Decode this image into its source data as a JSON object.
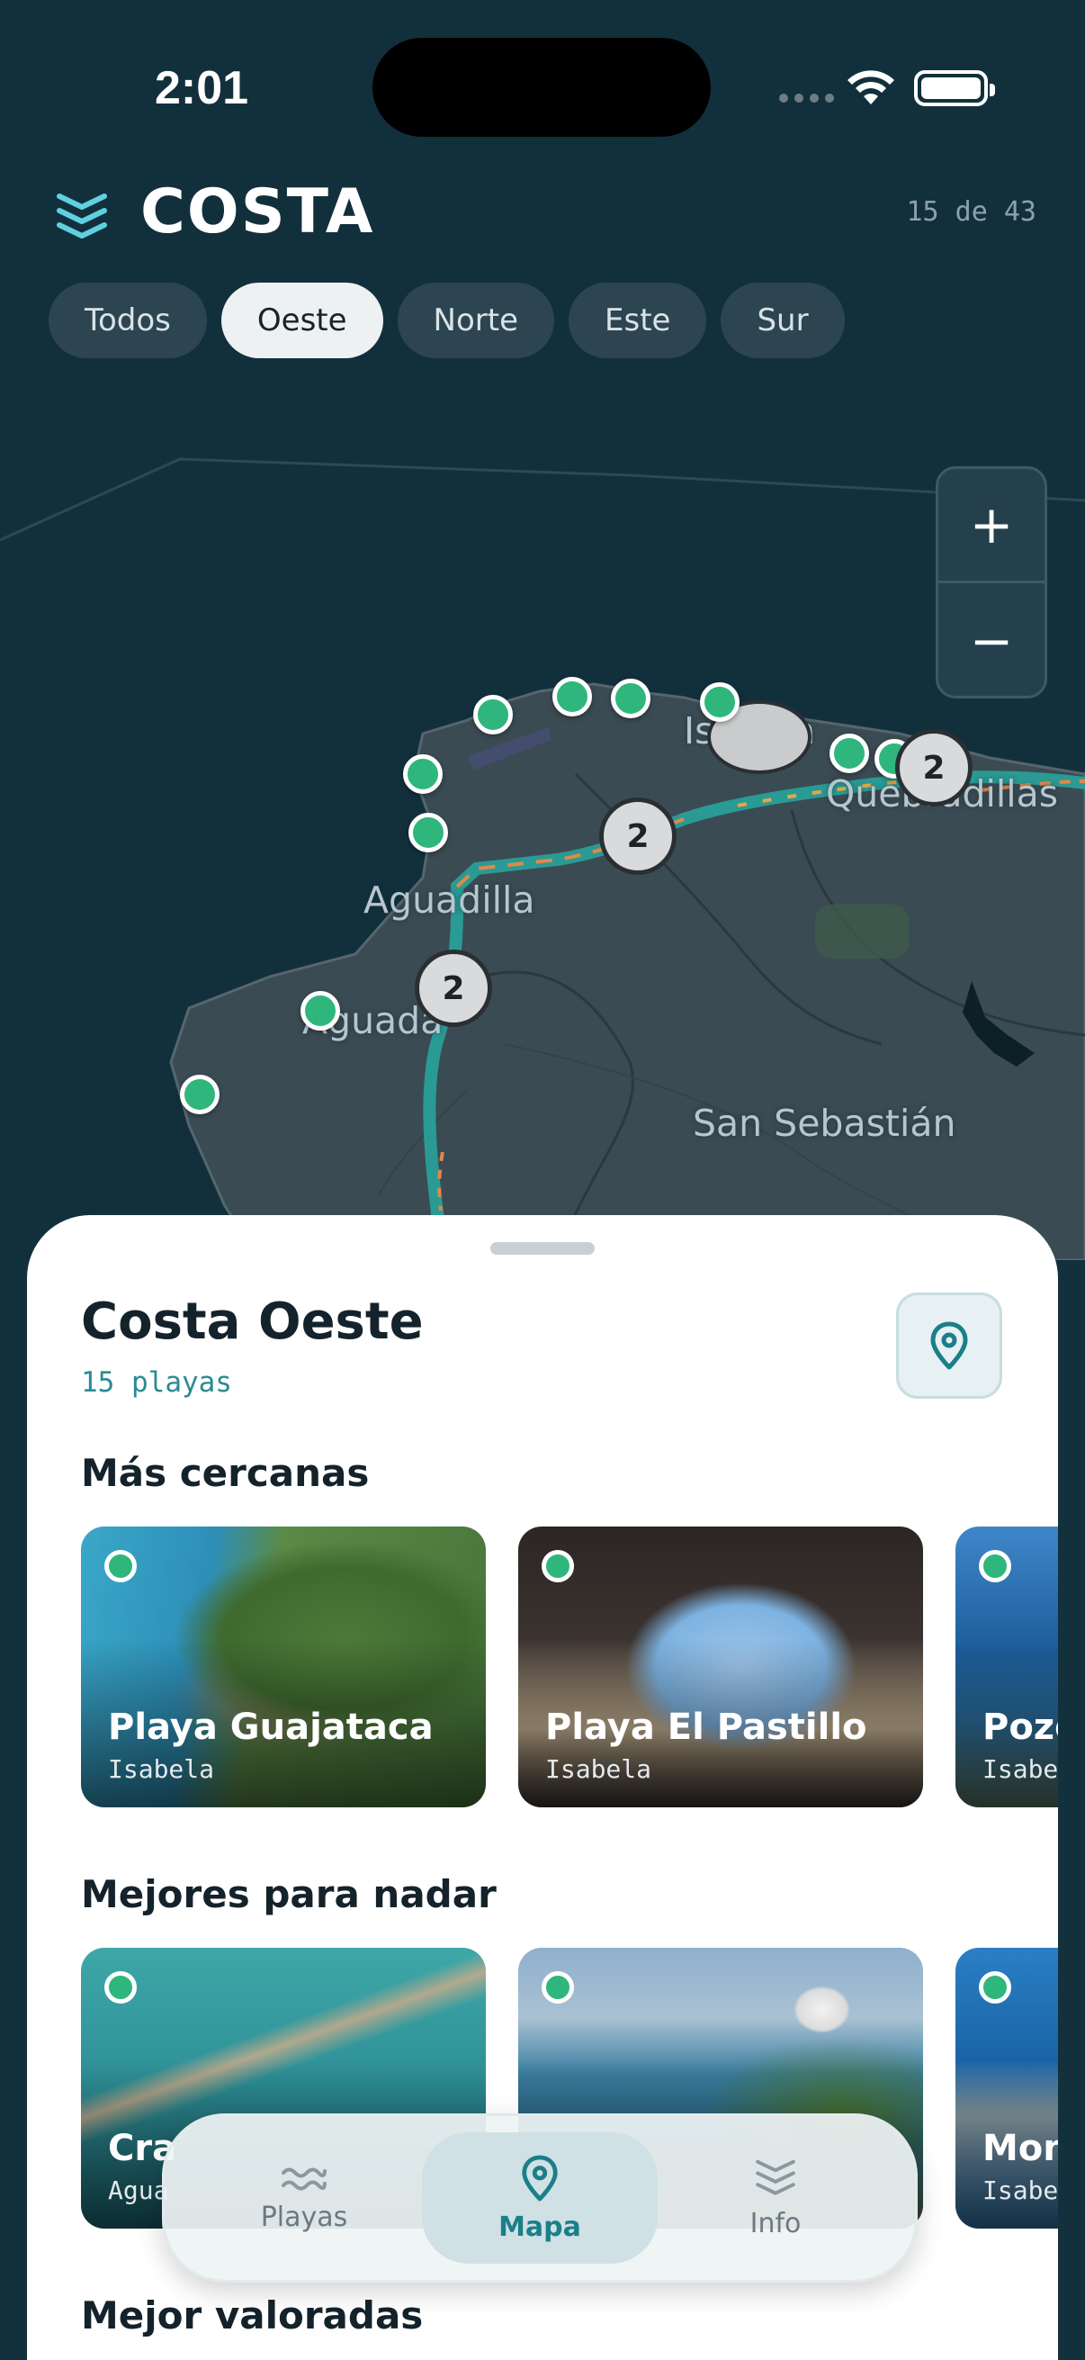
{
  "status_bar": {
    "time": "2:01"
  },
  "header": {
    "title": "COSTA",
    "counter": "15 de 43"
  },
  "filters": [
    {
      "label": "Todos",
      "active": false
    },
    {
      "label": "Oeste",
      "active": true
    },
    {
      "label": "Norte",
      "active": false
    },
    {
      "label": "Este",
      "active": false
    },
    {
      "label": "Sur",
      "active": false
    }
  ],
  "map": {
    "zoom_in": "+",
    "zoom_out": "−",
    "labels": {
      "isabela": "Isabela",
      "quebradillas": "Quebradillas",
      "aguadilla": "Aguadilla",
      "aguada": "Aguada",
      "san_sebastian": "San Sebastián"
    },
    "clusters": [
      "2",
      "2",
      "2"
    ]
  },
  "sheet": {
    "title": "Costa Oeste",
    "subtitle": "15 playas",
    "sections": [
      {
        "title": "Más cercanas",
        "cards": [
          {
            "name": "Playa Guajataca",
            "town": "Isabela"
          },
          {
            "name": "Playa El Pastillo",
            "town": "Isabela"
          },
          {
            "name": "Pozo",
            "town": "Isabela"
          }
        ]
      },
      {
        "title": "Mejores para nadar",
        "cards": [
          {
            "name": "Cra",
            "town": "Agua"
          },
          {
            "name": "",
            "town": ""
          },
          {
            "name": "Mon",
            "town": "Isabe"
          }
        ]
      },
      {
        "title": "Mejor valoradas",
        "cards": []
      }
    ]
  },
  "tabbar": [
    {
      "label": "Playas",
      "icon": "waves-icon",
      "active": false
    },
    {
      "label": "Mapa",
      "icon": "map-pin-icon",
      "active": true
    },
    {
      "label": "Info",
      "icon": "layers-icon",
      "active": false
    }
  ],
  "colors": {
    "map_bg": "#12303c",
    "land": "#3b4b53",
    "pin": "#2fb67c",
    "accent": "#1b7f8a",
    "coast_road": "#2a9a94"
  }
}
